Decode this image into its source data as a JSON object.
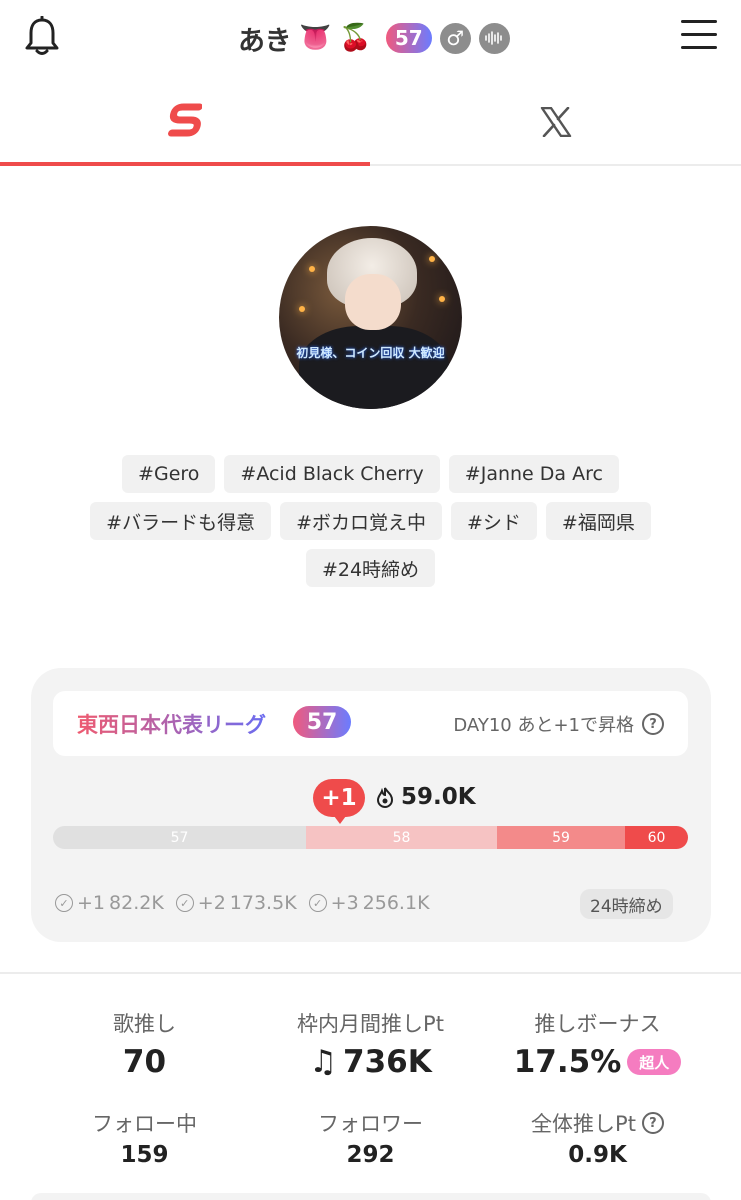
{
  "header": {
    "user_name": "あき",
    "emoji_1": "👅",
    "emoji_2": "🍒",
    "level": "57",
    "gender_symbol": "♂",
    "icons": [
      "bell-icon",
      "male-icon",
      "voice-icon",
      "menu-icon"
    ]
  },
  "tabs": [
    {
      "name": "showroom",
      "icon": "showroom-logo-icon",
      "active": true
    },
    {
      "name": "x",
      "icon": "x-logo-icon",
      "active": false
    }
  ],
  "avatar": {
    "banner_text": "初見様、コイン回収 大歓迎"
  },
  "tags": {
    "row1": [
      "#Gero",
      "#Acid Black Cherry",
      "#Janne Da Arc"
    ],
    "row2": [
      "#バラードも得意",
      "#ボカロ覚え中",
      "#シド",
      "#福岡県"
    ],
    "row3": [
      "#24時締め"
    ]
  },
  "league": {
    "name": "東西日本代表リーグ",
    "badge": "57",
    "status": "DAY10 あと+1で昇格",
    "plus_badge": "+1",
    "points": "59.0K",
    "segments": [
      "57",
      "58",
      "59",
      "60"
    ],
    "targets": [
      {
        "label": "+1",
        "value": "82.2K"
      },
      {
        "label": "+2",
        "value": "173.5K"
      },
      {
        "label": "+3",
        "value": "256.1K"
      }
    ],
    "deadline": "24時締め"
  },
  "stats": {
    "song_oshi": {
      "label": "歌推し",
      "value": "70"
    },
    "monthly": {
      "label": "枠内月間推しPt",
      "value": "736K"
    },
    "bonus": {
      "label": "推しボーナス",
      "value": "17.5%",
      "badge": "超人"
    },
    "following": {
      "label": "フォロー中",
      "value": "159"
    },
    "followers": {
      "label": "フォロワー",
      "value": "292"
    },
    "total": {
      "label": "全体推しPt",
      "value": "0.9K"
    }
  },
  "colors": {
    "accent": "#ef4b4b",
    "badge_gradient_start": "#f05a7e",
    "badge_gradient_end": "#6b7cff",
    "super_badge": "#f57cc0"
  }
}
